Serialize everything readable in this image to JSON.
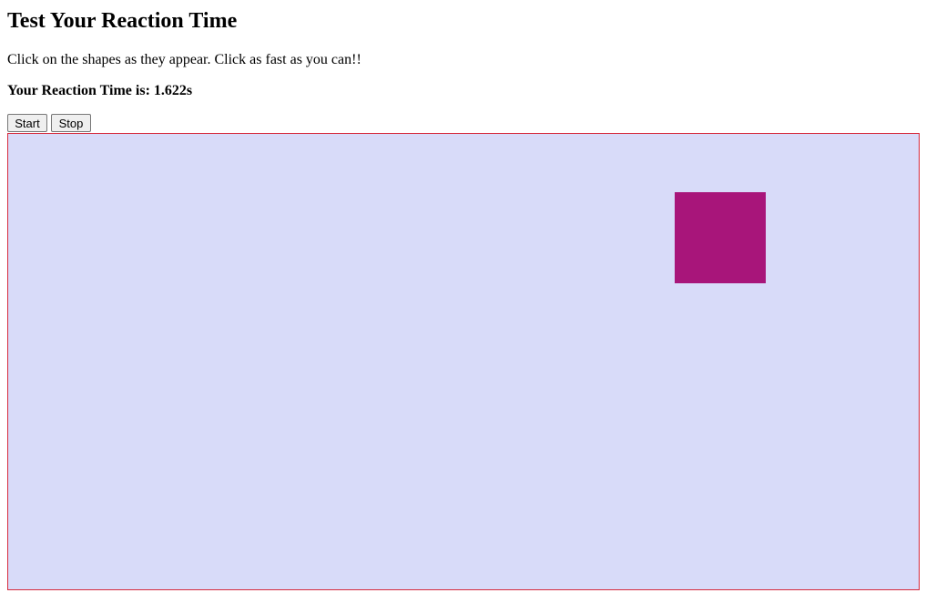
{
  "page": {
    "title": "Test Your Reaction Time",
    "instructions": "Click on the shapes as they appear. Click as fast as you can!!",
    "reaction_label": "Your Reaction Time is: ",
    "reaction_value": "1.622s"
  },
  "controls": {
    "start_label": "Start",
    "stop_label": "Stop"
  },
  "game_area": {
    "background_color": "#d8dbf9",
    "border_color": "#d62a3c"
  },
  "shape": {
    "type": "square",
    "color": "#a8157a"
  }
}
